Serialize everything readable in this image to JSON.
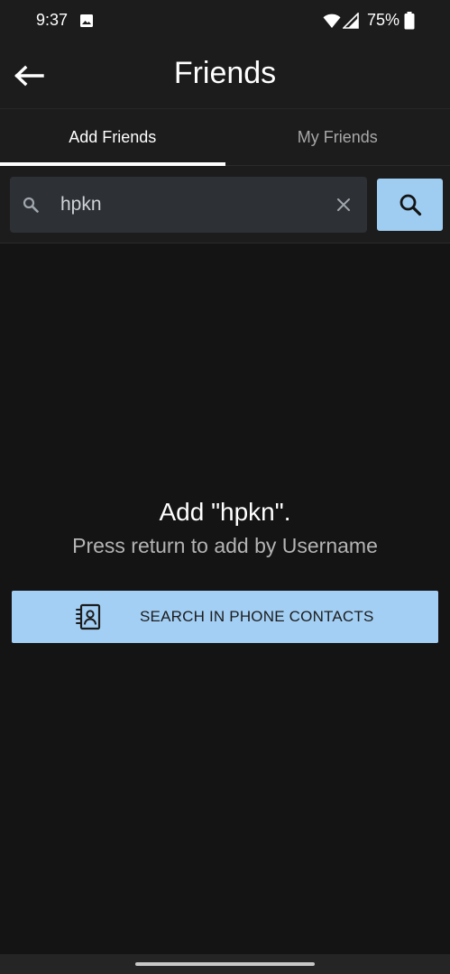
{
  "status_bar": {
    "time": "9:37",
    "battery_percent": "75%",
    "icons": [
      "gallery-icon",
      "wifi-icon",
      "signal-icon",
      "battery-icon"
    ]
  },
  "header": {
    "title": "Friends",
    "back_icon": "arrow-left-icon"
  },
  "tabs": [
    {
      "label": "Add Friends",
      "active": true
    },
    {
      "label": "My Friends",
      "active": false
    }
  ],
  "search": {
    "value": "hpkn",
    "placeholder": "",
    "leading_icon": "search-icon",
    "clear_icon": "close-icon",
    "submit_icon": "search-icon"
  },
  "empty_state": {
    "prompt": "Add \"hpkn\".",
    "hint": "Press return to add by Username"
  },
  "contacts_button": {
    "label": "SEARCH IN PHONE CONTACTS",
    "icon": "contacts-icon"
  },
  "colors": {
    "background": "#141414",
    "surface": "#1c1c1c",
    "search_field": "#2d3136",
    "accent": "#9fcdf2",
    "button_text": "#1c1c1c"
  }
}
